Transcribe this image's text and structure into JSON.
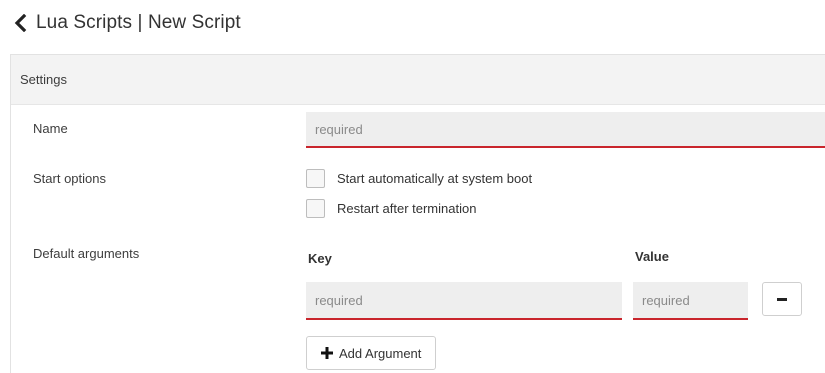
{
  "header": {
    "back_icon": "chevron-left-icon",
    "title": "Lua Scripts | New Script"
  },
  "settings": {
    "heading": "Settings",
    "name": {
      "label": "Name",
      "value": "",
      "placeholder": "required"
    },
    "start_options": {
      "label": "Start options",
      "options": [
        {
          "label": "Start automatically at system boot",
          "checked": false
        },
        {
          "label": "Restart after termination",
          "checked": false
        }
      ]
    },
    "default_arguments": {
      "label": "Default arguments",
      "key_header": "Key",
      "value_header": "Value",
      "rows": [
        {
          "key_placeholder": "required",
          "value_placeholder": "required"
        }
      ],
      "remove_icon": "minus-icon",
      "add_button_label": "Add Argument",
      "add_icon": "plus-icon"
    }
  },
  "colors": {
    "required_underline": "#c9252c",
    "field_background": "#eeeeee",
    "panel_header_background": "#f3f3f3"
  }
}
